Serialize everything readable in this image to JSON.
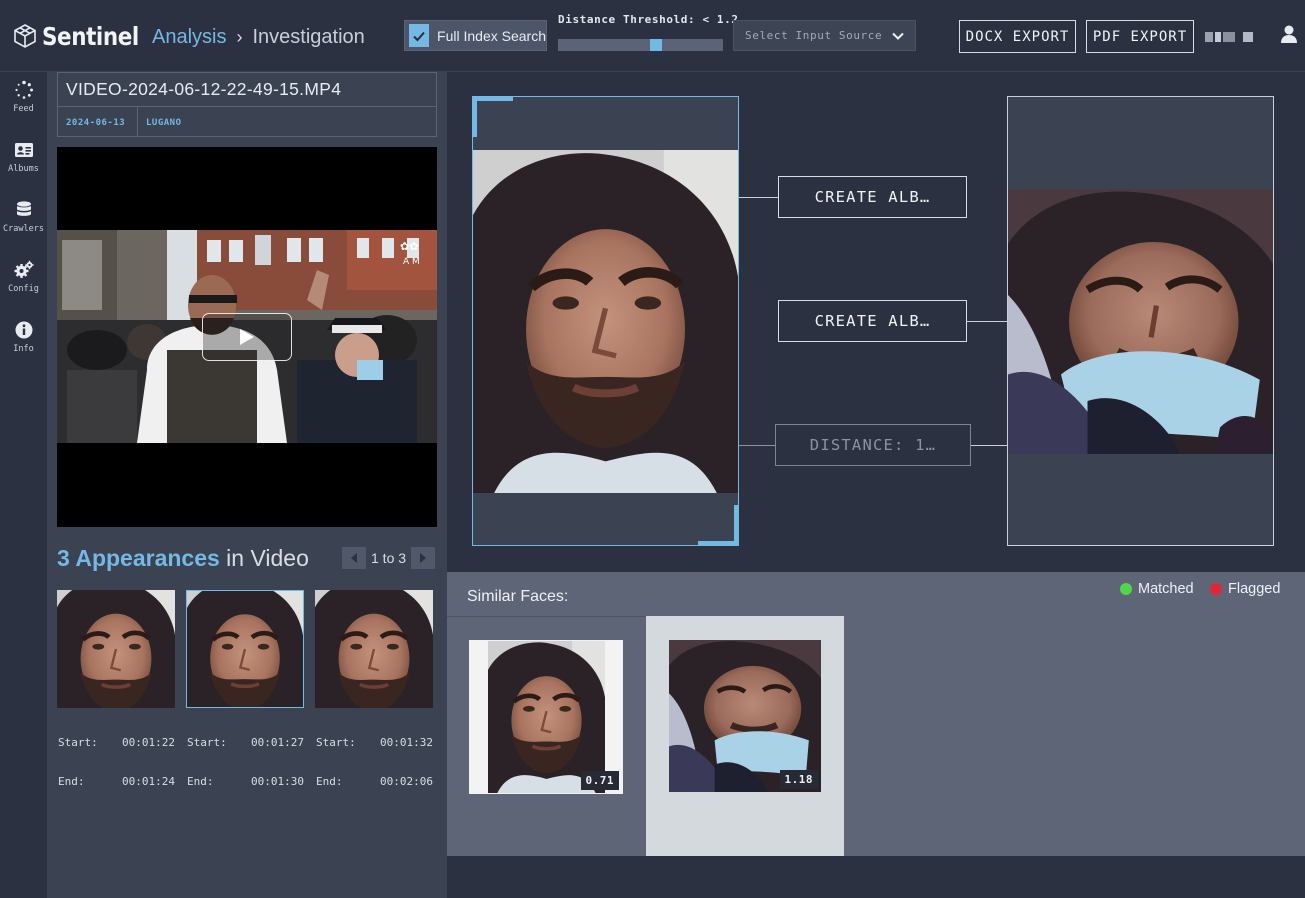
{
  "app": {
    "logo_text": "Sentinel",
    "breadcrumb": [
      "Analysis",
      "Investigation"
    ],
    "breadcrumb_sep": "›"
  },
  "toolbar": {
    "full_index_label": "Full Index Search",
    "full_index_checked": true,
    "threshold_label": "Distance Threshold: < 1.2",
    "threshold_value": 1.2,
    "source_placeholder": "Select Input Source",
    "docx_label": "DOCX EXPORT",
    "pdf_label": "PDF EXPORT"
  },
  "nav": [
    {
      "label": "Feed",
      "icon": "spinner-icon"
    },
    {
      "label": "Albums",
      "icon": "id-card-icon"
    },
    {
      "label": "Crawlers",
      "icon": "database-icon"
    },
    {
      "label": "Config",
      "icon": "gears-icon"
    },
    {
      "label": "Info",
      "icon": "info-icon"
    }
  ],
  "file": {
    "name": "VIDEO-2024-06-12-22-49-15.MP4",
    "date": "2024-06-13",
    "location": "LUGANO"
  },
  "appearances": {
    "count_label": "3 Appearances",
    "rest_label": " in Video",
    "pager": "1 to 3",
    "items": [
      {
        "start_label": "Start:",
        "start": "00:01:22",
        "end_label": "End:",
        "end": "00:01:24",
        "selected": false
      },
      {
        "start_label": "Start:",
        "start": "00:01:27",
        "end_label": "End:",
        "end": "00:01:30",
        "selected": true
      },
      {
        "start_label": "Start:",
        "start": "00:01:32",
        "end_label": "End:",
        "end": "00:02:06",
        "selected": false
      }
    ]
  },
  "compare": {
    "create_album_1": "CREATE ALB…",
    "create_album_2": "CREATE ALB…",
    "distance": "DISTANCE: 1…"
  },
  "similar": {
    "title": "Similar Faces:",
    "legend_matched": "Matched",
    "legend_flagged": "Flagged",
    "matched_color": "#4fd84a",
    "flagged_color": "#e0273a",
    "faces": [
      {
        "score": "0.71",
        "selected": false
      },
      {
        "score": "1.18",
        "selected": true
      }
    ]
  },
  "colors": {
    "accent": "#74b9e3",
    "background": "#2b3140",
    "panel": "#3b4252"
  }
}
